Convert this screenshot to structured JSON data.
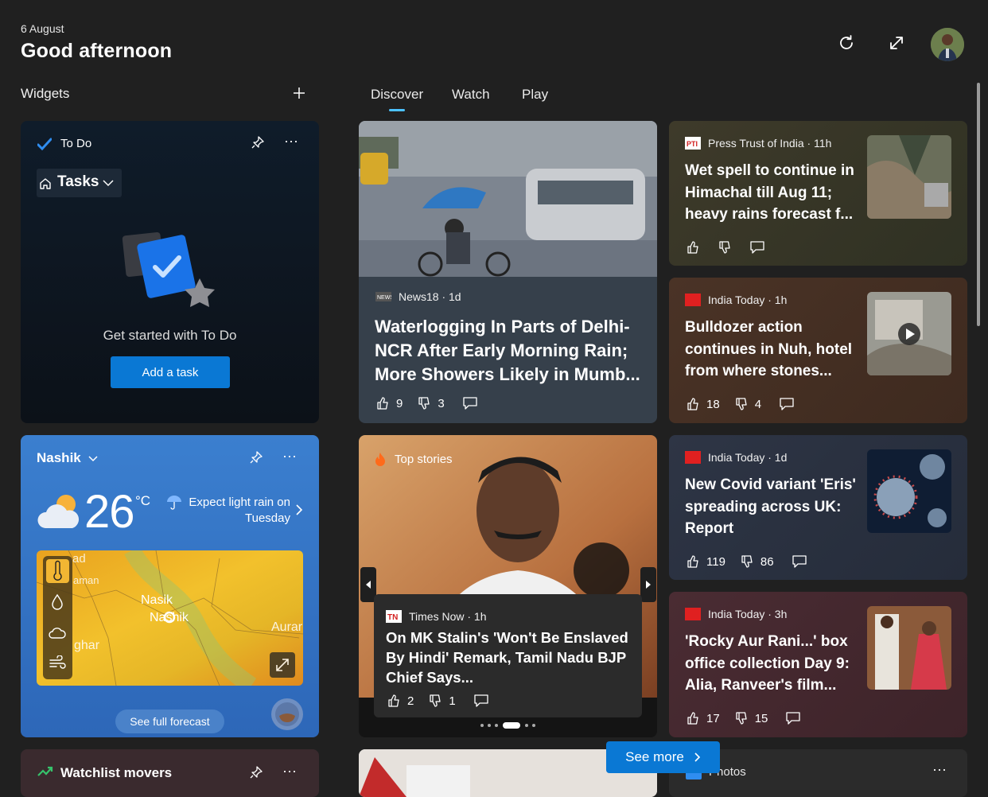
{
  "header": {
    "date": "6 August",
    "greeting": "Good afternoon"
  },
  "left": {
    "widgets_label": "Widgets"
  },
  "tabs": [
    {
      "label": "Discover"
    },
    {
      "label": "Watch"
    },
    {
      "label": "Play"
    }
  ],
  "todo": {
    "title": "To Do",
    "list_label": "Tasks",
    "message": "Get started with To Do",
    "add_button": "Add a task"
  },
  "weather": {
    "city": "Nashik",
    "temperature": "26",
    "unit": "°C",
    "forecast": "Expect light rain on Tuesday",
    "see_full": "See full forecast",
    "map_labels": [
      "ad",
      "aman",
      "Nasik",
      "Nashik",
      "Aurar",
      "ghar"
    ]
  },
  "watchlist": {
    "title": "Watchlist movers"
  },
  "feed": {
    "big1": {
      "source": "News18 · 1d",
      "title": "Waterlogging In Parts of Delhi-NCR After Early Morning Rain; More Showers Likely in Mumb...",
      "likes": "9",
      "dislikes": "3"
    },
    "top": {
      "label": "Top stories",
      "source": "Times Now · 1h",
      "title": "On MK Stalin's 'Won't Be Enslaved By Hindi' Remark, Tamil Nadu BJP Chief Says...",
      "likes": "2",
      "dislikes": "1"
    },
    "pti": {
      "source": "Press Trust of India · 11h",
      "title": "Wet spell to continue in Himachal till Aug 11; heavy rains forecast f..."
    },
    "nuh": {
      "source": "India Today · 1h",
      "title": "Bulldozer action continues in Nuh, hotel from where stones...",
      "likes": "18",
      "dislikes": "4"
    },
    "covid": {
      "source": "India Today · 1d",
      "title": "New Covid variant 'Eris' spreading across UK: Report",
      "likes": "119",
      "dislikes": "86"
    },
    "rocky": {
      "source": "India Today · 3h",
      "title": "'Rocky Aur Rani...' box office collection Day 9: Alia, Ranveer's film...",
      "likes": "17",
      "dislikes": "15"
    },
    "photos_label": "Photos"
  },
  "see_more": "See more",
  "colors": {
    "accent": "#0a78d4",
    "tab_underline": "#4cc2ff",
    "background": "#202020"
  }
}
